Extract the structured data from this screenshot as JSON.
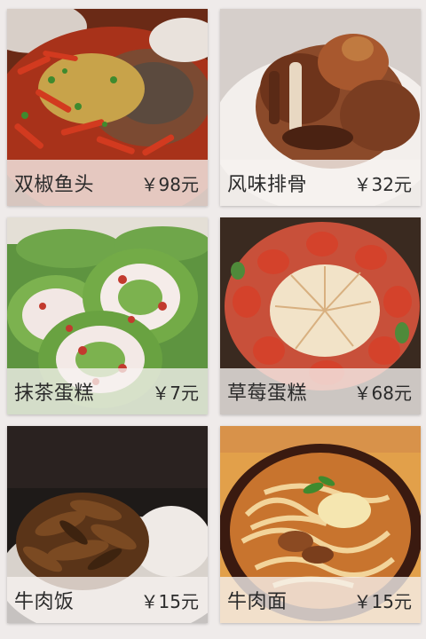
{
  "menu": {
    "items": [
      {
        "name": "双椒鱼头",
        "price": "￥98元",
        "photo": "spicy-fish-head-photo"
      },
      {
        "name": "风味排骨",
        "price": "￥32元",
        "photo": "spare-ribs-photo"
      },
      {
        "name": "抹茶蛋糕",
        "price": "￥7元",
        "photo": "matcha-roll-cake-photo"
      },
      {
        "name": "草莓蛋糕",
        "price": "￥68元",
        "photo": "strawberry-cake-photo"
      },
      {
        "name": "牛肉饭",
        "price": "￥15元",
        "photo": "beef-rice-photo"
      },
      {
        "name": "牛肉面",
        "price": "￥15元",
        "photo": "beef-noodle-photo"
      }
    ]
  }
}
